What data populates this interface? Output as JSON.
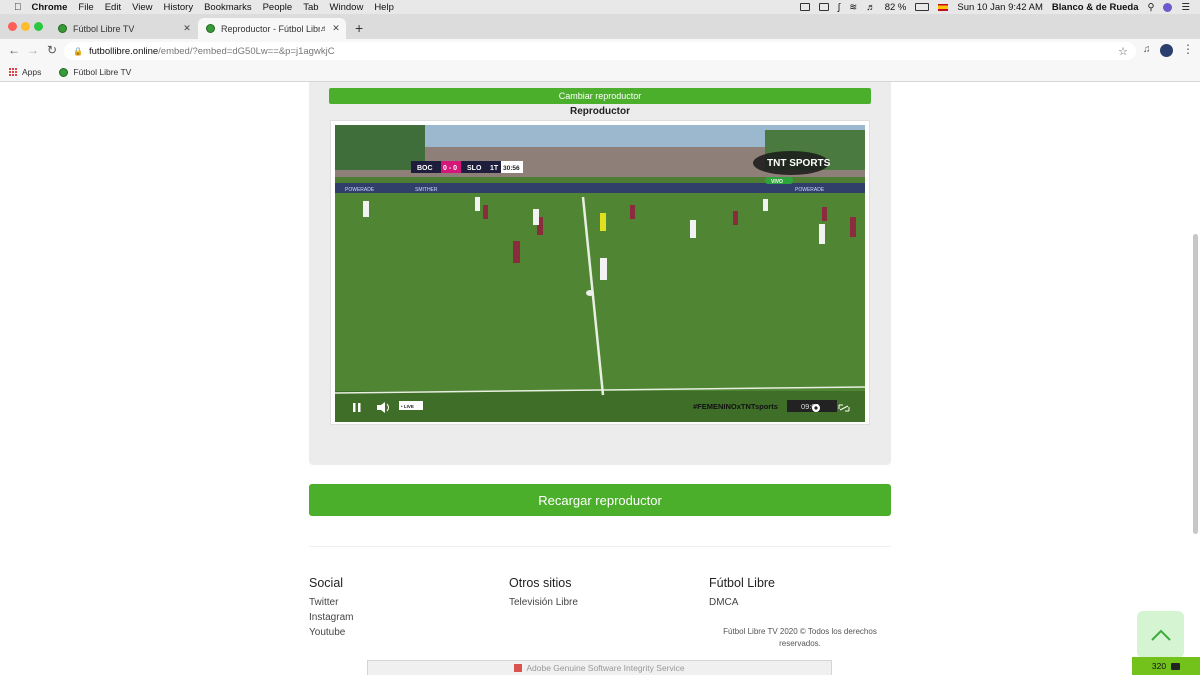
{
  "menubar": {
    "items": [
      "Chrome",
      "File",
      "Edit",
      "View",
      "History",
      "Bookmarks",
      "People",
      "Tab",
      "Window",
      "Help"
    ],
    "battery": "82 %",
    "clock": "Sun 10 Jan  9:42 AM",
    "user": "Blanco & de Rueda"
  },
  "tabs": [
    {
      "title": "Fútbol Libre TV"
    },
    {
      "title": "Reproductor - Fútbol Libre TV"
    }
  ],
  "address": {
    "host": "futbollibre.online",
    "path": "/embed/?embed=dG50Lw==&p=j1agwkjC"
  },
  "bookmarks": {
    "apps": "Apps",
    "item": "Fútbol Libre TV"
  },
  "player": {
    "switch_label": "Cambiar reproductor",
    "title": "Reproductor",
    "scoreboard": {
      "home": "BOC",
      "score": "0 - 0",
      "away": "SLO",
      "period": "1T",
      "clock": "30:56"
    },
    "broadcaster": "TNT SPORTS",
    "live_tag": "VIVO",
    "live_label": "• LIVE",
    "hashtag": "#FEMENINOxTNTsports",
    "brand_boards": [
      "POWERADE",
      "SMITHER",
      "POWERADE"
    ],
    "timestamp": "09:01",
    "reload_label": "Recargar reproductor"
  },
  "footer": {
    "social": {
      "heading": "Social",
      "links": [
        "Twitter",
        "Instagram",
        "Youtube"
      ]
    },
    "other": {
      "heading": "Otros sitios",
      "links": [
        "Televisión Libre"
      ]
    },
    "brand": {
      "heading": "Fútbol Libre",
      "links": [
        "DMCA"
      ]
    },
    "copyright": "Fútbol Libre TV 2020 © Todos los derechos reservados."
  },
  "adobe_notice": "Adobe Genuine Software Integrity Service",
  "counter": "320",
  "colors": {
    "accent": "#4caf2c",
    "pitch": "#4c7d32"
  }
}
